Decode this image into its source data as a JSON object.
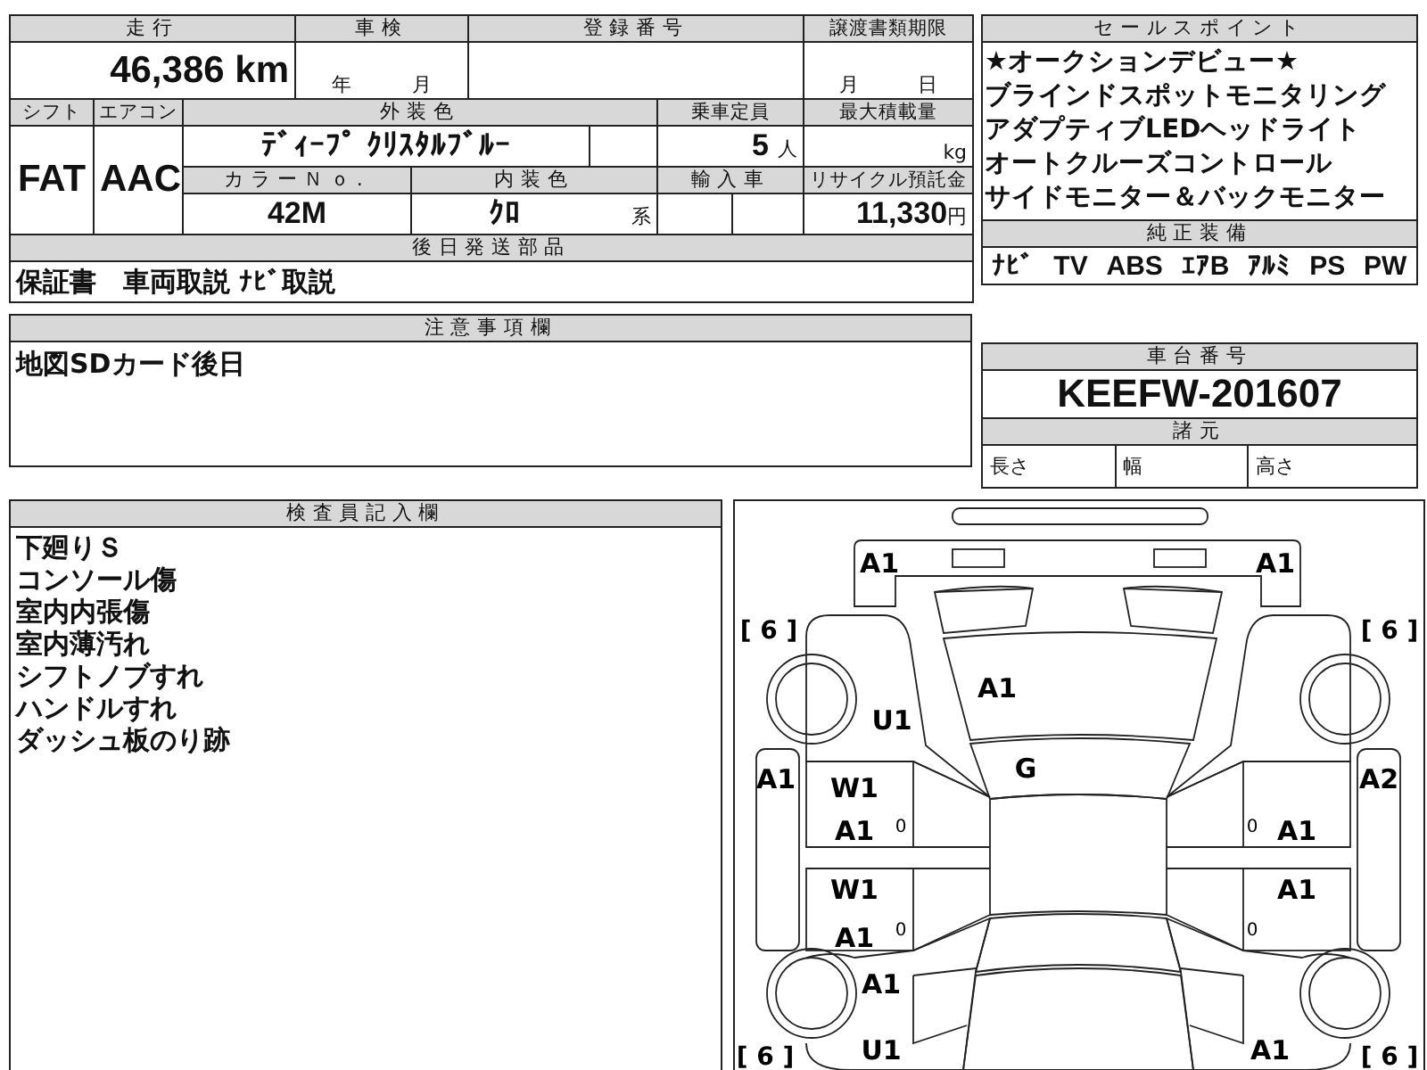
{
  "vehicle_table": {
    "mileage": {
      "label": "走行",
      "value": "46,386",
      "unit": "km"
    },
    "inspection": {
      "label": "車検",
      "year_unit": "年",
      "month_unit": "月"
    },
    "registration_number": {
      "label": "登録番号"
    },
    "document_deadline": {
      "label": "譲渡書類期限",
      "month_unit": "月",
      "day_unit": "日"
    },
    "shift": {
      "label": "シフト",
      "value": "FAT"
    },
    "air_conditioner": {
      "label": "エアコン",
      "value": "AAC"
    },
    "exterior_color": {
      "label": "外装色",
      "value": "ﾃﾞｨｰﾌﾟ ｸﾘｽﾀﾙﾌﾞﾙｰ"
    },
    "capacity": {
      "label": "乗車定員",
      "value": "5",
      "unit": "人"
    },
    "max_load": {
      "label": "最大積載量",
      "unit": "kg"
    },
    "color_no": {
      "label": "カラーＮｏ.",
      "value": "42M"
    },
    "interior_color": {
      "label": "内装色",
      "value": "ｸﾛ",
      "unit": "系"
    },
    "imported": {
      "label": "輸入車"
    },
    "recycling_fee": {
      "label": "リサイクル預託金",
      "value": "11,330",
      "unit": "円"
    },
    "parts_to_follow": {
      "label": "後日発送部品",
      "value": "保証書　車両取説 ﾅﾋﾞ取説"
    }
  },
  "notes": {
    "label": "注意事項欄",
    "value": "地図SDカード後日"
  },
  "sales_points": {
    "label": "セールスポイント",
    "items": [
      "★オークションデビュー★",
      "ブラインドスポットモニタリング",
      "アダプティブLEDヘッドライト",
      "オートクルーズコントロール",
      "サイドモニター＆バックモニター"
    ]
  },
  "equipment": {
    "label": "純正装備",
    "items": [
      "ﾅﾋﾞ",
      "TV",
      "ABS",
      "ｴｱB",
      "ｱﾙﾐ",
      "PS",
      "PW"
    ]
  },
  "chassis": {
    "label": "車台番号",
    "value": "KEEFW-201607"
  },
  "specs": {
    "label": "諸元",
    "items": [
      "長さ",
      "幅",
      "高さ"
    ]
  },
  "inspector_notes": {
    "label": "検査員記入欄",
    "lines": [
      "下廻りＳ",
      "コンソール傷",
      "室内内張傷",
      "室内薄汚れ",
      "シフトノブすれ",
      "ハンドルすれ",
      "ダッシュ板のり跡"
    ]
  },
  "diagram": {
    "tires": [
      "[ 6 ]",
      "[ 6 ]",
      "[ 6 ]",
      "[ 6 ]"
    ],
    "damage": [
      "A1",
      "A1",
      "A1",
      "U1",
      "G",
      "A1",
      "W1",
      "A1",
      "A2",
      "A1",
      "W1",
      "A1",
      "A1",
      "A1",
      "U1",
      "A1"
    ],
    "door_marks": [
      "0",
      "0",
      "0",
      "0"
    ]
  }
}
